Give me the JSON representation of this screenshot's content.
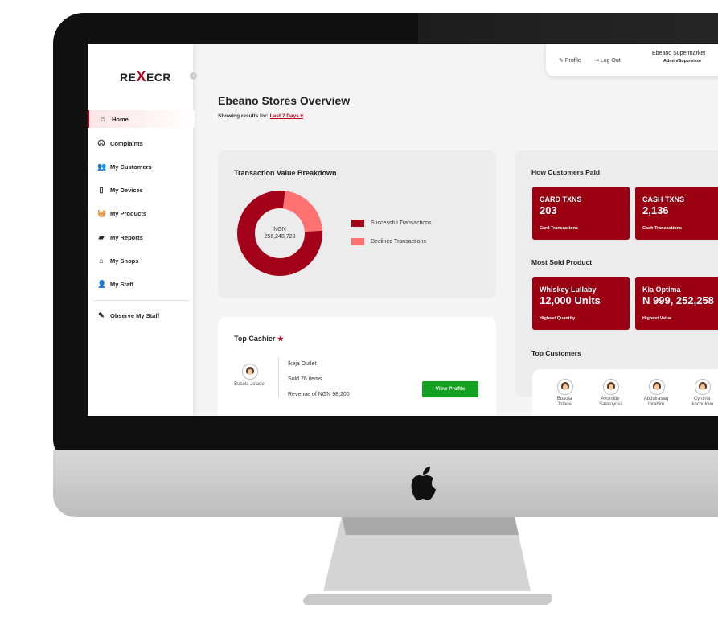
{
  "app": {
    "logo_left": "RE",
    "logo_x": "X",
    "logo_right": "ECR"
  },
  "sidebar": {
    "items": [
      {
        "label": "Home",
        "icon": "home-icon",
        "glyph": "⌂"
      },
      {
        "label": "Complaints",
        "icon": "complaints-icon",
        "glyph": "☹"
      },
      {
        "label": "My Customers",
        "icon": "customers-icon",
        "glyph": "👥"
      },
      {
        "label": "My Devices",
        "icon": "devices-icon",
        "glyph": "▯"
      },
      {
        "label": "My Products",
        "icon": "products-icon",
        "glyph": "🧺"
      },
      {
        "label": "My Reports",
        "icon": "reports-icon",
        "glyph": "▰"
      },
      {
        "label": "My Shops",
        "icon": "shops-icon",
        "glyph": "⌂"
      },
      {
        "label": "My Staff",
        "icon": "staff-icon",
        "glyph": "👤"
      },
      {
        "label": "Observe My Staff",
        "icon": "observe-icon",
        "glyph": "✎"
      }
    ]
  },
  "topbar": {
    "profile": "Profile",
    "logout": "Log Out",
    "store": "Ebeano Supermarket",
    "role": "Admin/Supervisor"
  },
  "main": {
    "title": "Ebeano Stores Overview",
    "showing_label": "Showing results for:",
    "range": "Last 7 Days ▾"
  },
  "breakdown": {
    "title": "Transaction Value Breakdown",
    "center_currency": "NGN",
    "center_value": "256,248,728",
    "successful_fraction": 0.78,
    "legend": [
      "Successful Transactions",
      "Declined Transactions"
    ],
    "colors": {
      "successful": "#a3001a",
      "declined": "#ff7272"
    }
  },
  "top_cashier": {
    "title": "Top Cashier",
    "name": "Busola Jolade",
    "outlet": "Ikeja Outlet",
    "sold": "Sold 76 items",
    "revenue": "Revenue of NGN 98,200",
    "button": "View Profile"
  },
  "paid": {
    "title": "How Customers Paid",
    "tiles": [
      {
        "label": "CARD TXNS",
        "value": "203",
        "sub": "Card Transactions"
      },
      {
        "label": "CASH TXNS",
        "value": "2,136",
        "sub": "Cash Transactions"
      }
    ]
  },
  "most_sold": {
    "title": "Most Sold Product",
    "tiles": [
      {
        "label": "Whiskey Lullaby",
        "value": "12,000 Units",
        "sub": "Highest Quantity"
      },
      {
        "label": "Kia Optima",
        "value": "N 999, 252,258",
        "sub": "Highest Value"
      }
    ]
  },
  "top_customers": {
    "title": "Top Customers",
    "list": [
      {
        "first": "Busola",
        "last": "Jolade"
      },
      {
        "first": "Ayomide",
        "last": "Salatoyosi"
      },
      {
        "first": "Abdulrasaq",
        "last": "Ibrahim"
      },
      {
        "first": "Cynthia",
        "last": "Ikechukwu"
      }
    ]
  },
  "colors": {
    "brand": "#b8001c",
    "tile": "#9b0012",
    "success_button": "#12a020"
  }
}
